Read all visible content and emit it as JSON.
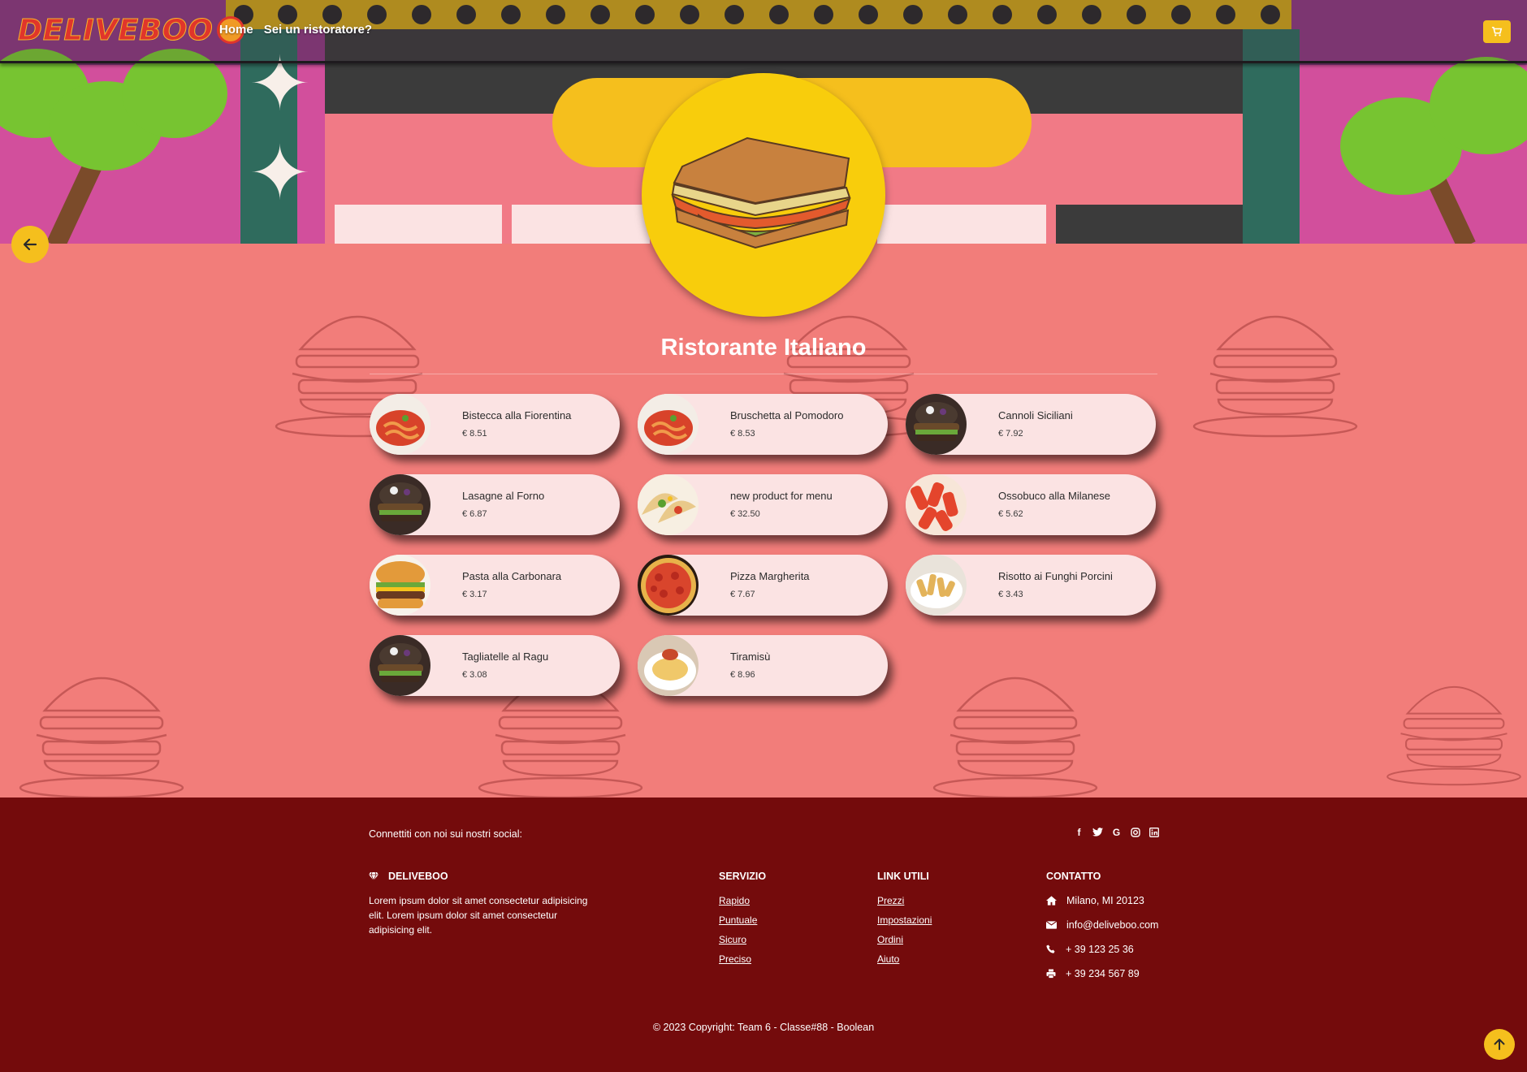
{
  "navbar": {
    "logo_text": "DELIVEBOO",
    "links": [
      "Home",
      "Sei un ristoratore?"
    ],
    "cart_icon": "cart-icon"
  },
  "restaurant": {
    "name": "Ristorante Italiano",
    "avatar_icon": "sandwich-icon"
  },
  "menu": [
    {
      "name": "Bistecca alla Fiorentina",
      "price": "€ 8.51",
      "image": "pasta-image"
    },
    {
      "name": "Bruschetta al Pomodoro",
      "price": "€ 8.53",
      "image": "pasta-image"
    },
    {
      "name": "Cannoli Siciliani",
      "price": "€ 7.92",
      "image": "burger-image"
    },
    {
      "name": "Lasagne al Forno",
      "price": "€ 6.87",
      "image": "burger-image"
    },
    {
      "name": "new product for menu",
      "price": "€ 32.50",
      "image": "tacos-image"
    },
    {
      "name": "Ossobuco alla Milanese",
      "price": "€ 5.62",
      "image": "penne-image"
    },
    {
      "name": "Pasta alla Carbonara",
      "price": "€ 3.17",
      "image": "cheeseburger-image"
    },
    {
      "name": "Pizza Margherita",
      "price": "€ 7.67",
      "image": "pizza-image"
    },
    {
      "name": "Risotto ai Funghi Porcini",
      "price": "€ 3.43",
      "image": "fries-image"
    },
    {
      "name": "Tagliatelle al Ragu",
      "price": "€ 3.08",
      "image": "burger-image"
    },
    {
      "name": "Tiramisù",
      "price": "€ 8.96",
      "image": "dessert-image"
    }
  ],
  "footer": {
    "social_text": "Connettiti con noi sui nostri social:",
    "social_icons": [
      "facebook-icon",
      "twitter-icon",
      "google-icon",
      "instagram-icon",
      "linkedin-icon"
    ],
    "brand_title": "DELIVEBOO",
    "brand_text": "Lorem ipsum dolor sit amet consectetur adipisicing elit. Lorem ipsum dolor sit amet consectetur adipisicing elit.",
    "servizio": {
      "title": "SERVIZIO",
      "links": [
        "Rapido",
        "Puntuale",
        "Sicuro",
        "Preciso"
      ]
    },
    "link_utili": {
      "title": "LINK UTILI",
      "links": [
        "Prezzi",
        "Impostazioni",
        "Ordini",
        "Aiuto"
      ]
    },
    "contatto": {
      "title": "CONTATTO",
      "address": "Milano, MI 20123",
      "email": "info@deliveboo.com",
      "phone": "+ 39 123 25 36",
      "fax": "+ 39 234 567 89"
    },
    "copyright": "© 2023 Copyright: Team 6 - Classe#88 - Boolean"
  },
  "colors": {
    "accent_yellow": "#f5bf1d",
    "page_background": "#f27d7a",
    "card_background": "#fbe3e3",
    "footer_background": "#740b0c"
  }
}
